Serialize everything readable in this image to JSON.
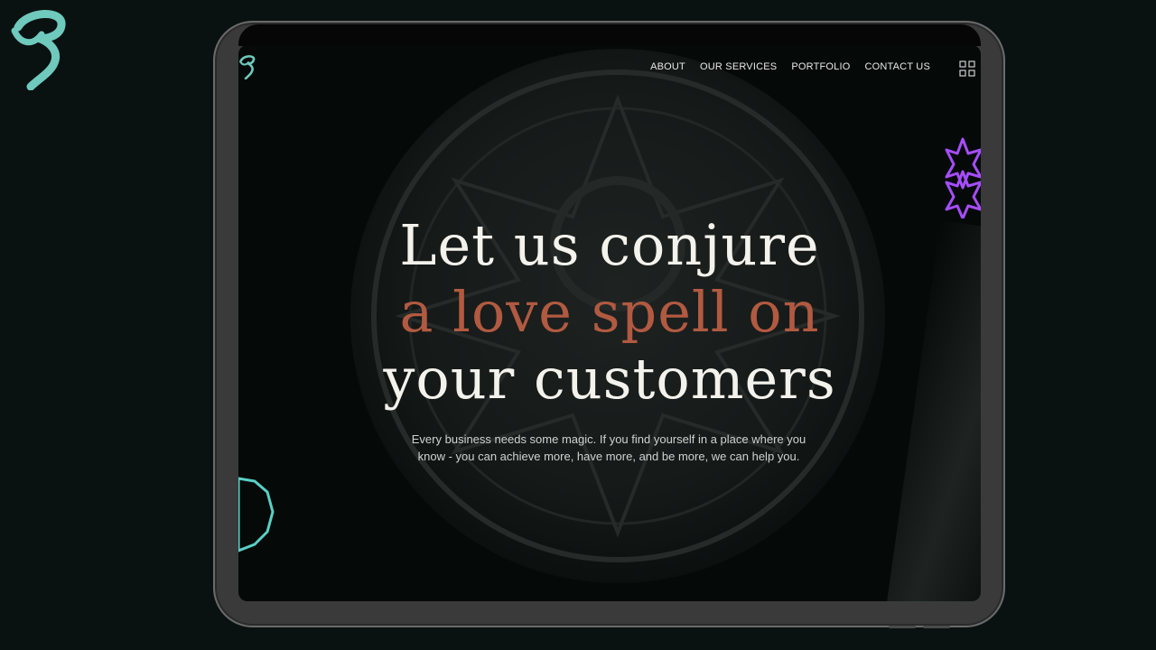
{
  "nav": {
    "items": [
      {
        "label": "ABOUT"
      },
      {
        "label": "OUR SERVICES"
      },
      {
        "label": "PORTFOLIO"
      },
      {
        "label": "CONTACT US"
      }
    ],
    "menu_icon": "grid-menu-icon"
  },
  "hero": {
    "line1": "Let us conjure",
    "line2": "a love spell on",
    "line3": "your customers",
    "subtitle_line1": "Every business needs some magic. If you find yourself in a place where you",
    "subtitle_line2": "know - you can achieve more, have more, and be more, we can help you."
  },
  "colors": {
    "background": "#0a1211",
    "logo": "#6fc9bd",
    "accent": "#b15a41",
    "heading": "#f4f2ec",
    "star": "#a64dff",
    "ring": "#5ad0c5"
  },
  "icons": [
    "brand-logo-icon",
    "site-logo-icon",
    "grid-menu-icon",
    "neon-star-icon",
    "neon-ring-icon",
    "emblem-image"
  ]
}
